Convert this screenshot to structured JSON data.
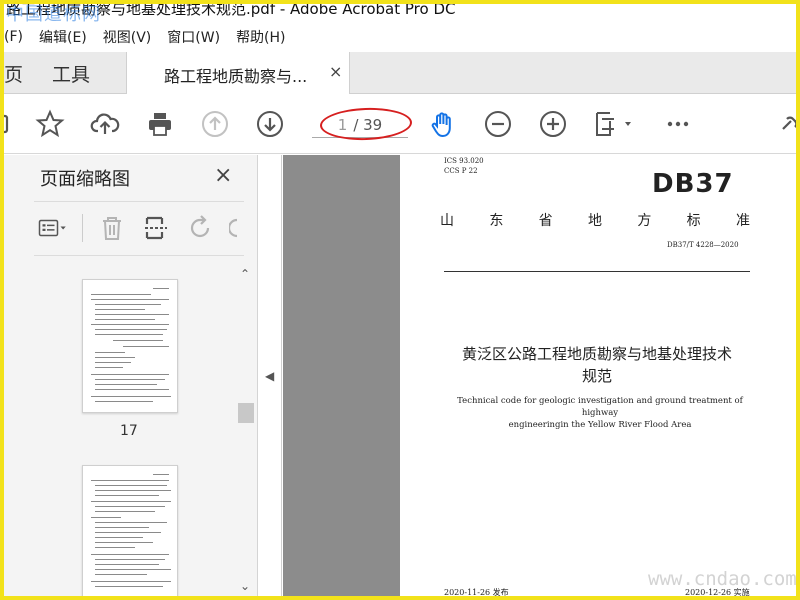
{
  "window": {
    "title": "路工程地质勘察与地基处理技术规范.pdf - Adobe Acrobat Pro DC",
    "watermark_top": "中国道标网"
  },
  "menu": [
    "(F)",
    "编辑(E)",
    "视图(V)",
    "窗口(W)",
    "帮助(H)"
  ],
  "tabs": {
    "home": "页",
    "tools": "工具",
    "doc_title": "路工程地质勘察与...",
    "close": "×"
  },
  "toolbar": {
    "page_current": "1",
    "page_total": "/ 39",
    "accent_color": "#1473e6",
    "annotation_color": "#d61f1f"
  },
  "panel": {
    "title": "页面缩略图",
    "close": "×",
    "thumb_page_label": "17"
  },
  "document": {
    "ics": "ICS  93.020",
    "ccs": "CCS  P 22",
    "code": "DB37",
    "province": [
      "山",
      "东",
      "省",
      "地",
      "方",
      "标",
      "准"
    ],
    "standard_no": "DB37/T  4228—2020",
    "title_cn_line1": "黄泛区公路工程地质勘察与地基处理技术",
    "title_cn_line2": "规范",
    "title_en_line1": "Technical code for geologic investigation and ground treatment of highway",
    "title_en_line2": "engineeringin the Yellow River Flood Area",
    "publish_date": "2020-11-26 发布",
    "implement_date": "2020-12-26 实施"
  },
  "watermark_bottom": "www.cndao.com"
}
